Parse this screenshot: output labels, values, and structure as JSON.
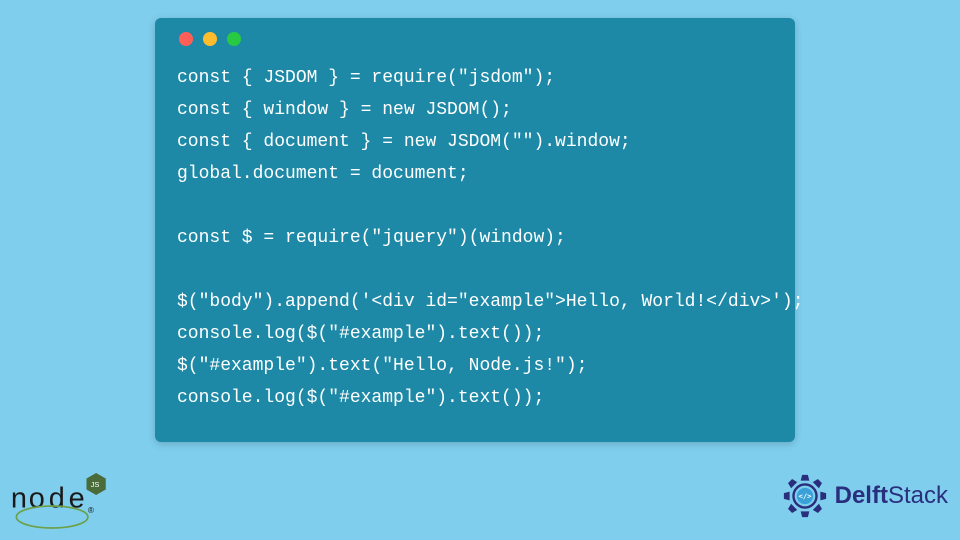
{
  "code": {
    "lines": [
      "const { JSDOM } = require(\"jsdom\");",
      "const { window } = new JSDOM();",
      "const { document } = new JSDOM(\"\").window;",
      "global.document = document;",
      "",
      "const $ = require(\"jquery\")(window);",
      "",
      "$(\"body\").append('<div id=\"example\">Hello, World!</div>');",
      "console.log($(\"#example\").text());",
      "$(\"#example\").text(\"Hello, Node.js!\");",
      "console.log($(\"#example\").text());"
    ]
  },
  "logos": {
    "node_label": "node",
    "delft_bold": "Delft",
    "delft_rest": "Stack"
  }
}
